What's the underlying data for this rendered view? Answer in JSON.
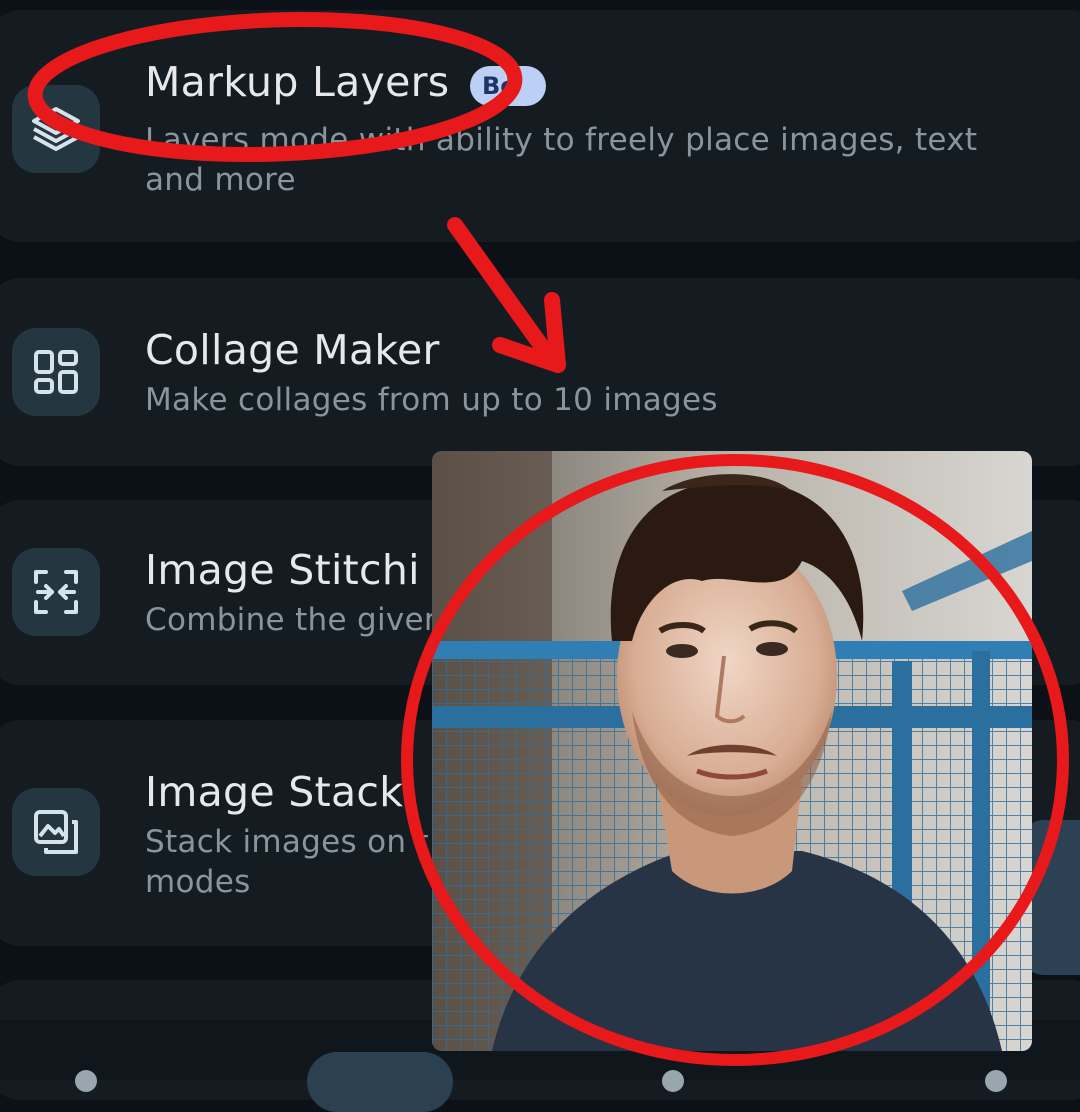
{
  "tools": [
    {
      "title": "Markup Layers",
      "badge": "Be",
      "subtitle_line1": "Layers mode with ability to freely place images, text",
      "subtitle_line2": "and more",
      "icon": "layers-icon"
    },
    {
      "title": "Collage Maker",
      "subtitle_line1": "Make collages from up to 10 images",
      "icon": "collage-grid-icon"
    },
    {
      "title": "Image Stitchi",
      "subtitle_line1": "Combine the giver",
      "icon": "stitch-arrows-icon"
    },
    {
      "title": "Image Stacki",
      "subtitle_line1": "Stack images on t",
      "subtitle_line2": "modes",
      "icon": "image-stack-icon"
    }
  ],
  "overlay": {
    "annotation_color": "#e8191b",
    "photo": "portrait-photo"
  },
  "colors": {
    "background": "#0b1116",
    "card": "#141c22",
    "icon_tile": "#243640",
    "icon_stroke": "#d7e3ea",
    "title": "#e6e8ea",
    "subtitle": "#8a949b",
    "badge_bg": "#bcd0f5",
    "badge_text": "#1d3566"
  }
}
